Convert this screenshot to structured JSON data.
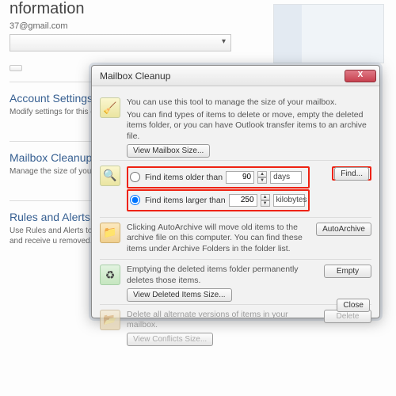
{
  "bg": {
    "header": "nformation",
    "email": "37@gmail.com",
    "account_settings": {
      "title": "Account Settings",
      "desc": "Modify settings for this\nconnections."
    },
    "mailbox_cleanup": {
      "title": "Mailbox Cleanup",
      "desc": "Manage the size of your\narchiving."
    },
    "rules_alerts": {
      "title": "Rules and Alerts",
      "desc": "Use Rules and Alerts to h\nmessages, and receive u\nremoved."
    }
  },
  "dialog": {
    "title": "Mailbox Cleanup",
    "intro": {
      "line1": "You can use this tool to manage the size of your mailbox.",
      "line2": "You can find types of items to delete or move, empty the deleted items folder, or you can have Outlook transfer items to an archive file.",
      "view_size_btn": "View Mailbox Size..."
    },
    "find": {
      "older_label": "Find items older than",
      "older_value": "90",
      "older_unit": "days",
      "larger_label": "Find items larger than",
      "larger_value": "250",
      "larger_unit": "kilobytes",
      "find_btn": "Find..."
    },
    "archive": {
      "text": "Clicking AutoArchive will move old items to the archive file on this computer. You can find these items under Archive Folders in the folder list.",
      "btn": "AutoArchive"
    },
    "empty": {
      "text": "Emptying the deleted items folder permanently deletes those items.",
      "view_btn": "View Deleted Items Size...",
      "btn": "Empty"
    },
    "conflicts": {
      "text": "Delete all alternate versions of items in your mailbox.",
      "view_btn": "View Conflicts Size...",
      "btn": "Delete"
    },
    "close_btn": "Close"
  }
}
